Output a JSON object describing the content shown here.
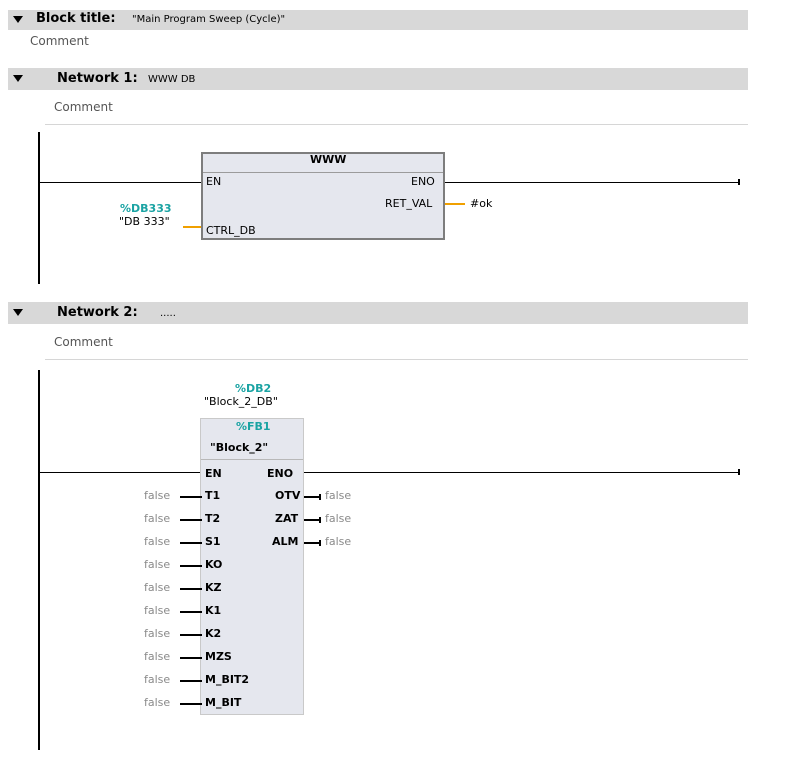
{
  "block": {
    "title_label": "Block title:",
    "title_value": "\"Main Program Sweep (Cycle)\"",
    "comment": "Comment"
  },
  "networks": [
    {
      "label": "Network 1:",
      "title": "WWW DB",
      "comment": "Comment",
      "box_title": "WWW",
      "pins_left": [
        "EN",
        "CTRL_DB"
      ],
      "pins_right": [
        "ENO",
        "RET_VAL"
      ],
      "db_address": "%DB333",
      "db_name": "\"DB 333\"",
      "ret_operand": "#ok"
    },
    {
      "label": "Network 2:",
      "title": ".....",
      "comment": "Comment",
      "instance_db_address": "%DB2",
      "instance_db_name": "\"Block_2_DB\"",
      "fb_address": "%FB1",
      "fb_name": "\"Block_2\"",
      "inputs": [
        {
          "pin": "EN"
        },
        {
          "pin": "T1",
          "value": "false"
        },
        {
          "pin": "T2",
          "value": "false"
        },
        {
          "pin": "S1",
          "value": "false"
        },
        {
          "pin": "KO",
          "value": "false"
        },
        {
          "pin": "KZ",
          "value": "false"
        },
        {
          "pin": "K1",
          "value": "false"
        },
        {
          "pin": "K2",
          "value": "false"
        },
        {
          "pin": "MZS",
          "value": "false"
        },
        {
          "pin": "M_BIT2",
          "value": "false"
        },
        {
          "pin": "M_BIT",
          "value": "false"
        }
      ],
      "outputs": [
        {
          "pin": "ENO"
        },
        {
          "pin": "OTV",
          "value": "false"
        },
        {
          "pin": "ZAT",
          "value": "false"
        },
        {
          "pin": "ALM",
          "value": "false"
        }
      ]
    }
  ],
  "colors": {
    "header_bg": "#d8d8d8",
    "box_bg": "#e5e7ee",
    "operand_address": "#1aa3a3",
    "wire_orange": "#f0a000"
  }
}
